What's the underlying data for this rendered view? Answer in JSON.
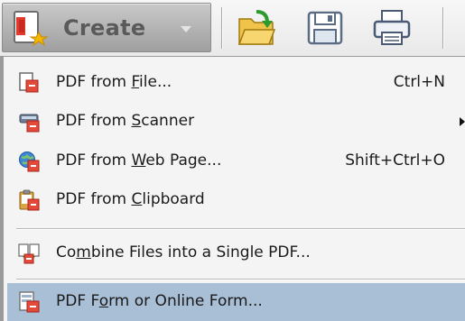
{
  "toolbar": {
    "create_label": "Create",
    "icons": [
      "create-pdf-icon",
      "dropdown-arrow-icon",
      "open-folder-icon",
      "save-disk-icon",
      "print-icon"
    ]
  },
  "menu": {
    "items": [
      {
        "label_pre": "PDF from ",
        "label_key": "F",
        "label_post": "ile...",
        "shortcut": "Ctrl+N",
        "icon": "pdf-from-file-icon",
        "submenu": false
      },
      {
        "label_pre": "PDF from ",
        "label_key": "S",
        "label_post": "canner",
        "shortcut": "",
        "icon": "scanner-icon",
        "submenu": true
      },
      {
        "label_pre": "PDF from ",
        "label_key": "W",
        "label_post": "eb Page...",
        "shortcut": "Shift+Ctrl+O",
        "icon": "web-page-icon",
        "submenu": false
      },
      {
        "label_pre": "PDF from ",
        "label_key": "C",
        "label_post": "lipboard",
        "shortcut": "",
        "icon": "clipboard-icon",
        "submenu": false
      },
      {
        "label_pre": "Co",
        "label_key": "m",
        "label_post": "bine Files into a Single PDF...",
        "shortcut": "",
        "icon": "combine-files-icon",
        "submenu": false
      },
      {
        "label_pre": "PDF F",
        "label_key": "o",
        "label_post": "rm or Online Form...",
        "shortcut": "",
        "icon": "pdf-form-icon",
        "submenu": false,
        "highlighted": true
      }
    ]
  },
  "colors": {
    "menu_background": "#f4f4f4",
    "highlight": "#a9bfd6",
    "create_button": "#b4b4b4"
  }
}
